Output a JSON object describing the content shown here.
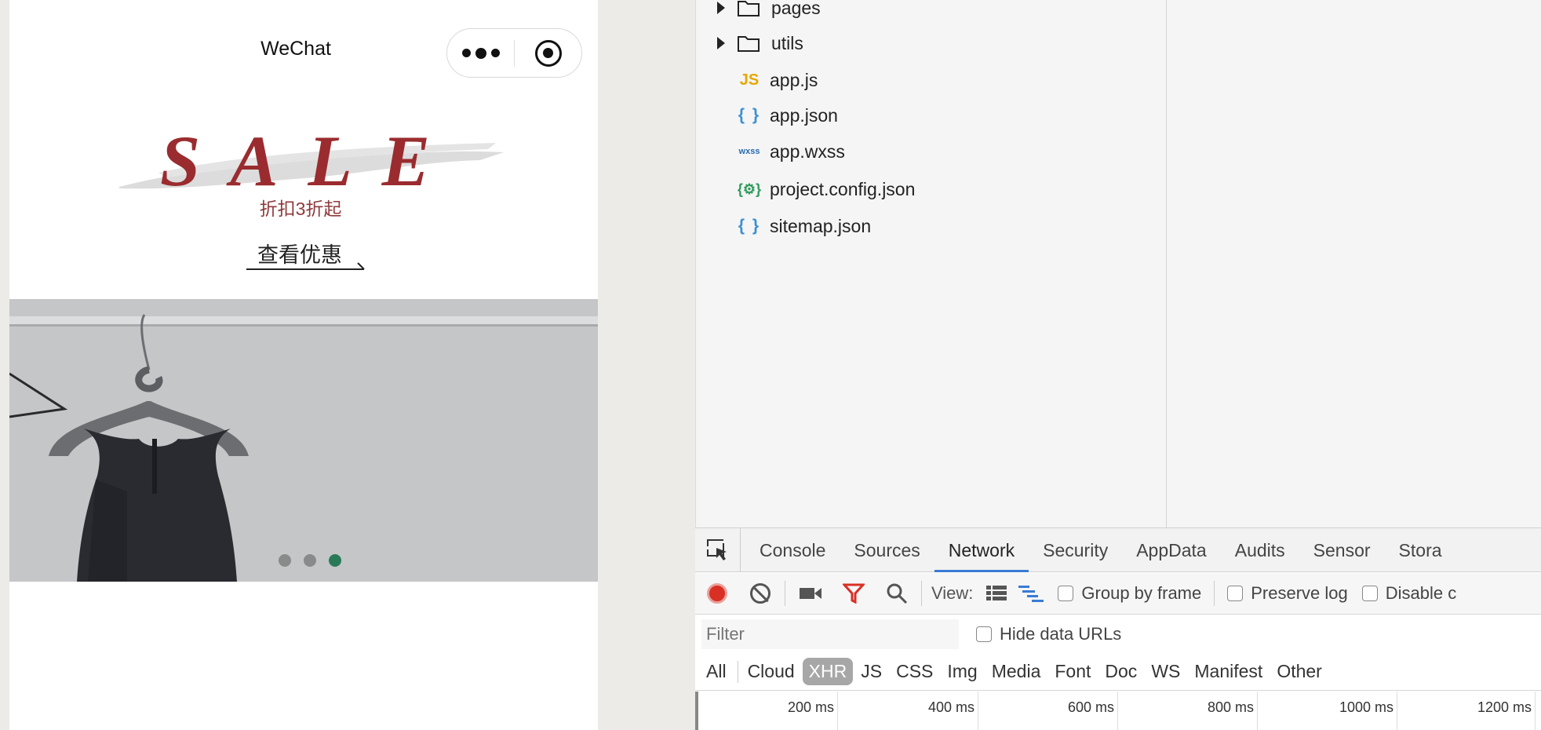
{
  "simulator": {
    "nav_title": "WeChat",
    "sale_word": "SALE",
    "sale_subtitle": "折扣3折起",
    "view_deal_label": "查看优惠",
    "banner_dots": {
      "count": 3,
      "active_index": 2,
      "active_color": "#2a7a58"
    }
  },
  "file_tree": {
    "items": [
      {
        "type": "folder",
        "name": "pages"
      },
      {
        "type": "folder",
        "name": "utils"
      },
      {
        "type": "file",
        "icon": "js-file-icon",
        "icon_text": "JS",
        "name": "app.js"
      },
      {
        "type": "file",
        "icon": "json-file-icon",
        "icon_text": "{ }",
        "name": "app.json"
      },
      {
        "type": "file",
        "icon": "wxss-file-icon",
        "icon_text": "wxss",
        "name": "app.wxss"
      },
      {
        "type": "file",
        "icon": "config-file-icon",
        "icon_text": "{⚙}",
        "name": "project.config.json"
      },
      {
        "type": "file",
        "icon": "json-file-icon",
        "icon_text": "{ }",
        "name": "sitemap.json"
      }
    ]
  },
  "devtools": {
    "tabs": [
      "Console",
      "Sources",
      "Network",
      "Security",
      "AppData",
      "Audits",
      "Sensor",
      "Stora"
    ],
    "active_tab": "Network",
    "toolbar": {
      "view_label": "View:",
      "group_by_frame": "Group by frame",
      "preserve_log": "Preserve log",
      "disable_cache": "Disable c"
    },
    "filter": {
      "placeholder": "Filter",
      "hide_data_urls": "Hide data URLs"
    },
    "types": [
      "All",
      "Cloud",
      "XHR",
      "JS",
      "CSS",
      "Img",
      "Media",
      "Font",
      "Doc",
      "WS",
      "Manifest",
      "Other"
    ],
    "active_type": "XHR",
    "timeline_ticks": [
      "200 ms",
      "400 ms",
      "600 ms",
      "800 ms",
      "1000 ms",
      "1200 ms"
    ],
    "record_color": "#d93025",
    "accent_color": "#3a7bd5"
  }
}
